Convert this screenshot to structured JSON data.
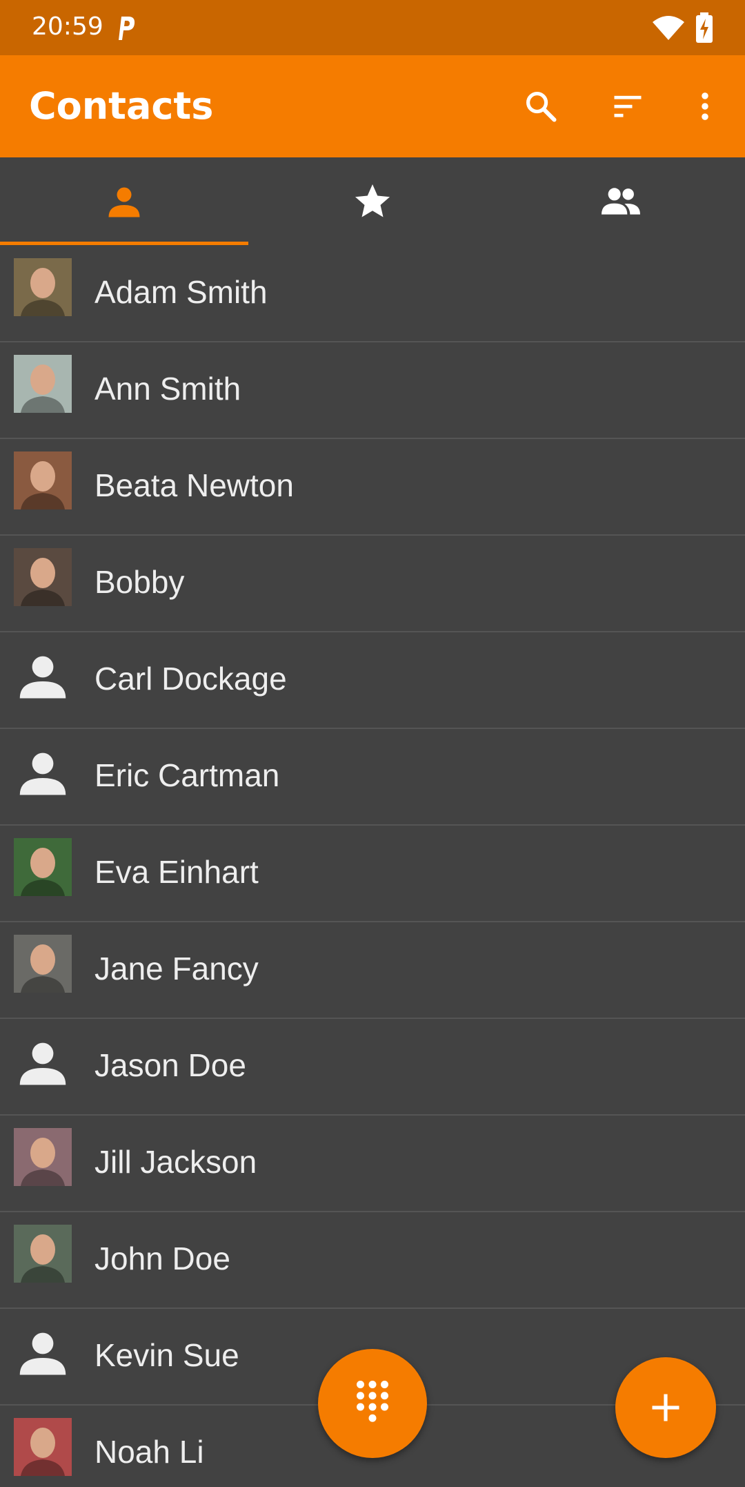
{
  "status_bar": {
    "time": "20:59"
  },
  "app_bar": {
    "title": "Contacts"
  },
  "tabs": [
    {
      "icon": "person-icon",
      "selected": true
    },
    {
      "icon": "star-icon",
      "selected": false
    },
    {
      "icon": "group-icon",
      "selected": false
    }
  ],
  "contacts": [
    {
      "name": "Adam Smith",
      "avatar": "photo",
      "avatar_color": "#7a6a4a"
    },
    {
      "name": "Ann Smith",
      "avatar": "photo",
      "avatar_color": "#a8b6b0"
    },
    {
      "name": "Beata Newton",
      "avatar": "photo",
      "avatar_color": "#8a5a40"
    },
    {
      "name": "Bobby",
      "avatar": "photo",
      "avatar_color": "#5a4a40"
    },
    {
      "name": "Carl Dockage",
      "avatar": "default"
    },
    {
      "name": "Eric Cartman",
      "avatar": "default"
    },
    {
      "name": "Eva Einhart",
      "avatar": "photo",
      "avatar_color": "#3f6a3a"
    },
    {
      "name": "Jane Fancy",
      "avatar": "photo",
      "avatar_color": "#6a6a66"
    },
    {
      "name": "Jason Doe",
      "avatar": "default"
    },
    {
      "name": "Jill Jackson",
      "avatar": "photo",
      "avatar_color": "#8a6a70"
    },
    {
      "name": "John Doe",
      "avatar": "photo",
      "avatar_color": "#5a6a5a"
    },
    {
      "name": "Kevin Sue",
      "avatar": "default"
    },
    {
      "name": "Noah Li",
      "avatar": "photo",
      "avatar_color": "#b04a4a"
    }
  ],
  "colors": {
    "accent": "#f57c00",
    "status_bar": "#c96600",
    "background": "#424242",
    "divider": "#555555"
  }
}
